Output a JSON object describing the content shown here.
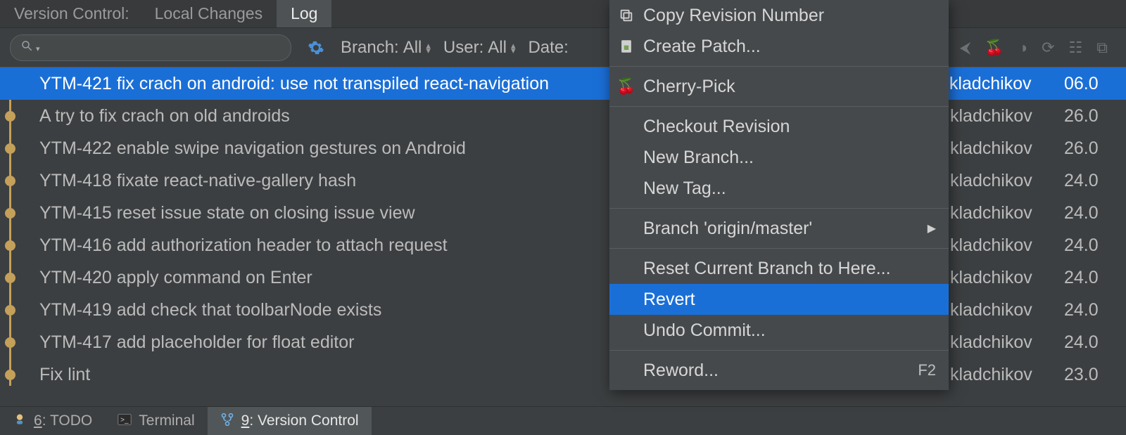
{
  "header": {
    "vc_label": "Version Control:",
    "tabs": [
      {
        "label": "Local Changes",
        "active": false
      },
      {
        "label": "Log",
        "active": true
      }
    ]
  },
  "filter": {
    "branch_label": "Branch:",
    "branch_value": "All",
    "user_label": "User:",
    "user_value": "All",
    "date_label": "Date:"
  },
  "commits": [
    {
      "message": "YTM-421 fix crach on android: use not transpiled react-navigation",
      "author_visible": "kladchikov",
      "date_visible": "06.0",
      "selected": true
    },
    {
      "message": "A try to fix crach on old androids",
      "author_visible": "kladchikov",
      "date_visible": "26.0",
      "selected": false
    },
    {
      "message": "YTM-422 enable swipe navigation gestures on Android",
      "author_visible": "kladchikov",
      "date_visible": "26.0",
      "selected": false
    },
    {
      "message": "YTM-418 fixate react-native-gallery hash",
      "author_visible": "kladchikov",
      "date_visible": "24.0",
      "selected": false
    },
    {
      "message": "YTM-415 reset issue state on closing issue view",
      "author_visible": "kladchikov",
      "date_visible": "24.0",
      "selected": false
    },
    {
      "message": "YTM-416 add authorization header to attach request",
      "author_visible": "kladchikov",
      "date_visible": "24.0",
      "selected": false
    },
    {
      "message": "YTM-420 apply command on Enter",
      "author_visible": "kladchikov",
      "date_visible": "24.0",
      "selected": false
    },
    {
      "message": "YTM-419 add check that toolbarNode exists",
      "author_visible": "kladchikov",
      "date_visible": "24.0",
      "selected": false
    },
    {
      "message": "YTM-417 add placeholder for float editor",
      "author_visible": "kladchikov",
      "date_visible": "24.0",
      "selected": false
    },
    {
      "message": "Fix lint",
      "author_visible": "kladchikov",
      "date_visible": "23.0",
      "selected": false
    }
  ],
  "context_menu": {
    "items": [
      {
        "label": "Copy Revision Number",
        "icon": "copy-icon"
      },
      {
        "label": "Create Patch...",
        "icon": "patch-icon"
      },
      {
        "sep": true
      },
      {
        "label": "Cherry-Pick",
        "icon": "cherry-icon"
      },
      {
        "sep": true
      },
      {
        "label": "Checkout Revision"
      },
      {
        "label": "New Branch..."
      },
      {
        "label": "New Tag..."
      },
      {
        "sep": true
      },
      {
        "label": "Branch 'origin/master'",
        "submenu": true
      },
      {
        "sep": true
      },
      {
        "label": "Reset Current Branch to Here..."
      },
      {
        "label": "Revert",
        "selected": true
      },
      {
        "label": "Undo Commit..."
      },
      {
        "sep": true
      },
      {
        "label": "Reword...",
        "shortcut": "F2"
      }
    ]
  },
  "bottom": {
    "todo_mn": "6",
    "todo_rest": ": TODO",
    "terminal": "Terminal",
    "vc_mn": "9",
    "vc_rest": ": Version Control"
  }
}
